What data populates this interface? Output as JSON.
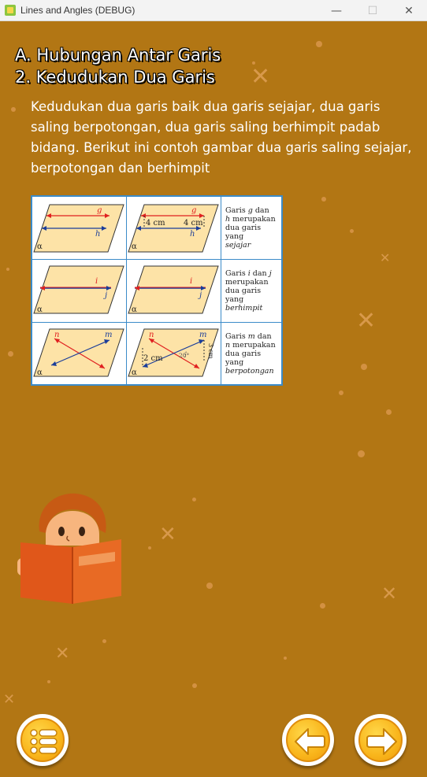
{
  "window": {
    "title": "Lines and Angles (DEBUG)",
    "min_glyph": "—",
    "max_glyph": "☐",
    "close_glyph": "✕"
  },
  "heading": {
    "section": "A. Hubungan Antar Garis",
    "subsection": "2. Kedudukan Dua Garis"
  },
  "paragraph": "Kedudukan dua garis baik dua garis sejajar, dua garis saling berpotongan, dua garis saling berhimpit padab bidang. Berikut ini contoh gambar dua garis saling sejajar, berpotongan dan berhimpit",
  "figure": {
    "plane_label": "α",
    "row_parallel": {
      "line_top": "g",
      "line_bottom": "h",
      "distance_left": "4 cm",
      "distance_right": "4 cm",
      "desc": [
        "Garis ",
        "g",
        " dan",
        "h",
        " merupakan",
        "dua garis yang",
        "sejajar"
      ]
    },
    "row_coincide": {
      "line_top": "i",
      "line_bottom": "j",
      "desc": [
        "Garis ",
        "i",
        " dan ",
        "j",
        "merupakan",
        "dua garis yang",
        "berhimpit"
      ]
    },
    "row_intersect": {
      "line_a": "n",
      "line_b": "m",
      "distance_left": "2 cm",
      "distance_right": "3 cm",
      "angle": "20°",
      "desc": [
        "Garis ",
        "m",
        " dan",
        "n",
        " merupakan",
        "dua garis yang",
        "berpotongan"
      ]
    }
  },
  "buttons": {
    "menu": "menu-icon",
    "prev": "arrow-left-icon",
    "next": "arrow-right-icon"
  },
  "colors": {
    "background": "#b27614",
    "plane_fill": "#fde3a7",
    "line_red": "#e02020",
    "line_blue": "#1a3d9a",
    "table_border": "#3b8bc9",
    "button_yellow": "#f9b51b"
  }
}
